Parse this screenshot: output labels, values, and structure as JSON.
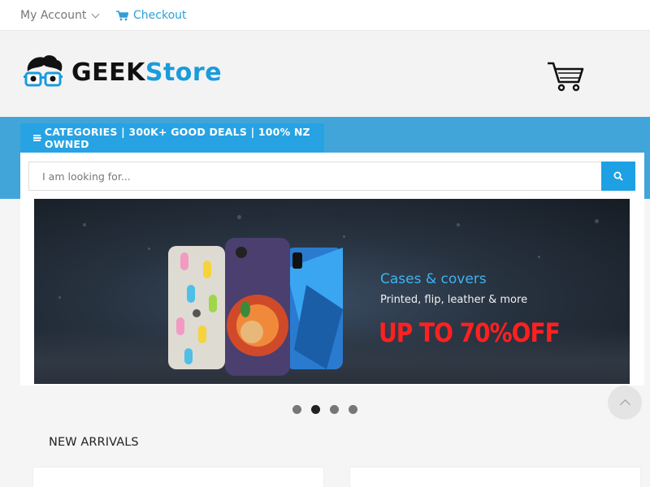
{
  "topbar": {
    "account_label": "My Account",
    "checkout_label": "Checkout"
  },
  "logo": {
    "part1": "GEEK",
    "part2": "Store"
  },
  "categories_bar": {
    "label": "CATEGORIES | 300K+ GOOD DEALS | 100% NZ OWNED"
  },
  "search": {
    "placeholder": "I am looking for...",
    "value": ""
  },
  "banner": {
    "title": "Cases & covers",
    "subtitle": "Printed, flip, leather & more",
    "promo": "UP TO 70%OFF"
  },
  "carousel": {
    "count": 4,
    "active_index": 1
  },
  "section": {
    "title": "NEW ARRIVALS"
  },
  "colors": {
    "accent": "#1da1e4",
    "bluebar": "#42a5d9",
    "promo_red": "#ff2020"
  }
}
